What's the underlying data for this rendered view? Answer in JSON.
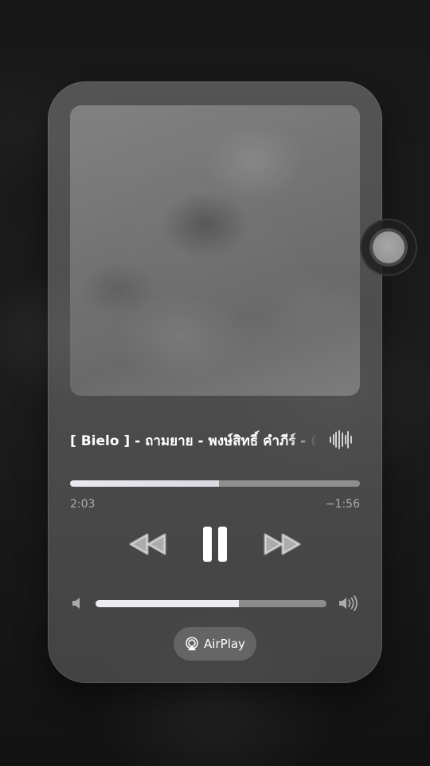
{
  "now_playing": {
    "track_title": "[ Bielo ] - ถามยาย - พงษ์สิทธิ์ คำภีร์ - (",
    "progress_fraction": 0.515,
    "elapsed_time": "2:03",
    "remaining_time": "−1:56"
  },
  "icons": {
    "waveform": "waveform-icon",
    "rewind": "backward-icon",
    "pause": "pause-icon",
    "forward": "forward-icon",
    "volume_low": "speaker-low-icon",
    "volume_high": "speaker-high-icon",
    "airplay": "airplay-icon",
    "assistive_touch": "assistive-touch-icon"
  },
  "volume": {
    "level_fraction": 0.62
  },
  "airplay": {
    "label": "AirPlay"
  },
  "colors": {
    "accent_fill": "#e9e9ef",
    "text_primary": "#ffffff",
    "text_secondary": "#9a9a9a"
  }
}
